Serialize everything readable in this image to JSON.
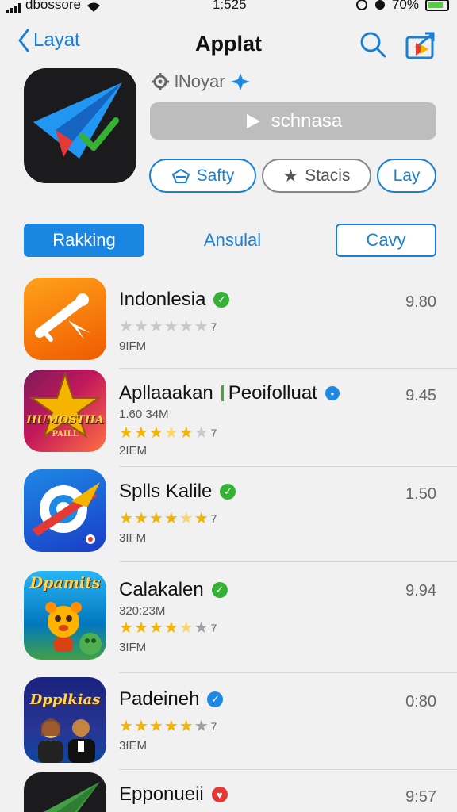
{
  "status": {
    "carrier": "dbossore",
    "time": "1:525",
    "battery": "70%"
  },
  "nav": {
    "back_label": "Layat",
    "title": "Applat"
  },
  "hero": {
    "developer": "lNoyar",
    "get_label": "schnasa",
    "pills": [
      "Safty",
      "Stacis",
      "Lay"
    ]
  },
  "tabs": [
    "Rakking",
    "Ansulal",
    "Cavy"
  ],
  "apps": [
    {
      "name": "Indonlesia",
      "badge": "green",
      "score": "9.80",
      "sub": "",
      "stars": 0,
      "reviews": "7",
      "meta": "9IFM"
    },
    {
      "name": "Apllaaakan",
      "name2": "Peoifolluat",
      "badge": "blue-dot",
      "score": "9.45",
      "sub": "1.60 34M",
      "stars": 3,
      "reviews": "7",
      "meta": "2IEM"
    },
    {
      "name": "Splls Kalile",
      "badge": "green",
      "score": "1.50",
      "sub": "",
      "stars": 4,
      "reviews": "7",
      "meta": "3IFM"
    },
    {
      "name": "Calakalen",
      "badge": "green",
      "score": "9.94",
      "sub": "320:23M",
      "stars": 3,
      "reviews": "7",
      "meta": "3IFM"
    },
    {
      "name": "Padeineh",
      "badge": "blue",
      "score": "0:80",
      "sub": "",
      "stars": 4,
      "reviews": "7",
      "meta": "3IEM"
    },
    {
      "name": "Epponueii",
      "badge": "red",
      "score": "9:57",
      "sub": "",
      "stars": 0,
      "reviews": "",
      "meta": ""
    }
  ],
  "icon_texts": {
    "app2": "HUMOSTHA",
    "app2b": "PAILL",
    "app4": "Dpamits",
    "app5": "Dpplkias"
  },
  "colors": {
    "accent": "#1a7fd6",
    "star": "#f4b400",
    "verified_green": "#34b233",
    "verified_blue": "#1e88e5",
    "heart_red": "#e53935"
  }
}
